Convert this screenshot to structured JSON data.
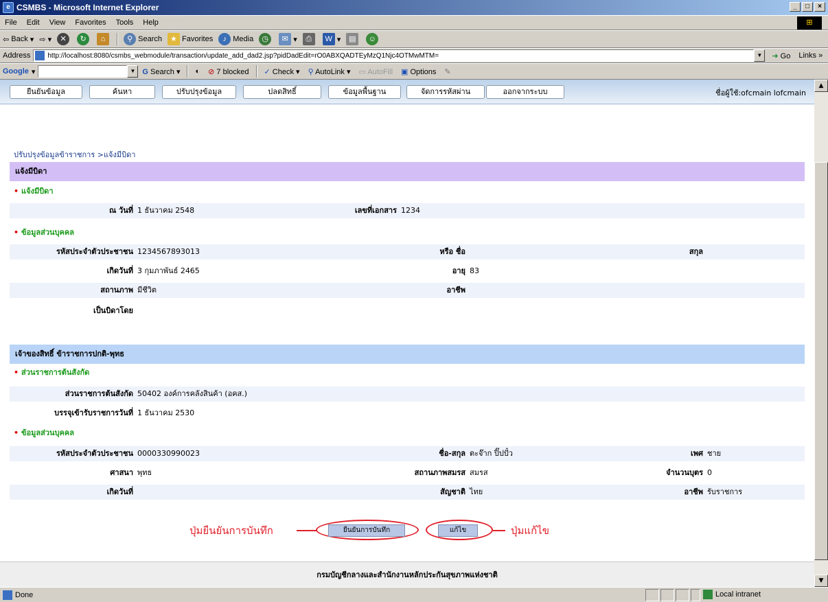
{
  "window": {
    "title": "CSMBS - Microsoft Internet Explorer",
    "controls": [
      "_",
      "□",
      "×"
    ]
  },
  "menu": [
    "File",
    "Edit",
    "View",
    "Favorites",
    "Tools",
    "Help"
  ],
  "toolbar": {
    "back": "Back",
    "search": "Search",
    "favorites": "Favorites",
    "media": "Media"
  },
  "address": {
    "label": "Address",
    "url": "http://localhost:8080/csmbs_webmodule/transaction/update_add_dad2.jsp?pidDadEdit=rO0ABXQADTEyMzQ1Njc4OTMwMTM=",
    "go": "Go",
    "links": "Links »"
  },
  "googlebar": {
    "brand": "Google",
    "search": "Search",
    "blocked": "7 blocked",
    "check": "Check",
    "autolink": "AutoLink",
    "autofill": "AutoFill",
    "options": "Options"
  },
  "nav": {
    "items": [
      "ยืนยันข้อมูล",
      "ค้นหา",
      "ปรับปรุงข้อมูล",
      "ปลดสิทธิ์",
      "ข้อมูลพื้นฐาน",
      "จัดการรหัสผ่าน",
      "ออกจากระบบ"
    ],
    "user": "ชื่อผู้ใช้:ofcmain lofcmain"
  },
  "breadcrumb": "ปรับปรุงข้อมูลข้าราชการ >แจ้งมีบิดา",
  "section1": {
    "header": "แจ้งมีบิดา",
    "sub1": "แจ้งมีบิดา",
    "date_label": "ณ วันที่",
    "date_value": "1 ธันวาคม 2548",
    "docno_label": "เลขที่เอกสาร",
    "docno_value": "1234",
    "sub2": "ข้อมูลส่วนบุคคล",
    "pid_label": "รหัสประจำตัวประชาชน",
    "pid_value": "1234567893013",
    "name_label": "หรือ ชื่อ",
    "surname_label": "สกุล",
    "birth_label": "เกิดวันที่",
    "birth_value": "3 กุมภาพันธ์ 2465",
    "age_label": "อายุ",
    "age_value": "83",
    "status_label": "สถานภาพ",
    "status_value": "มีชีวิต",
    "occupation_label": "อาชีพ",
    "father_by_label": "เป็นบิดาโดย"
  },
  "section2": {
    "header": "เจ้าของสิทธิ์ ข้าราชการปกติ-พุทธ",
    "sub1": "ส่วนราชการต้นสังกัด",
    "dept_label": "ส่วนราชการต้นสังกัด",
    "dept_value": "50402 องค์การคลังสินค้า (อคส.)",
    "start_label": "บรรจุเข้ารับราชการวันที่",
    "start_value": "1 ธันวาคม 2530",
    "sub2": "ข้อมูลส่วนบุคคล",
    "pid_label": "รหัสประจำตัวประชาชน",
    "pid_value": "0000330990023",
    "fullname_label": "ชื่อ-สกุล",
    "fullname_value": "ตะจ๊าก ปิ๊ปปั๋ว",
    "sex_label": "เพศ",
    "sex_value": "ชาย",
    "religion_label": "ศาสนา",
    "religion_value": "พุทธ",
    "marital_label": "สถานภาพสมรส",
    "marital_value": "สมรส",
    "children_label": "จำนวนบุตร",
    "children_value": "0",
    "birth_label": "เกิดวันที่",
    "nationality_label": "สัญชาติ",
    "nationality_value": "ไทย",
    "occupation_label": "อาชีพ",
    "occupation_value": "รับราชการ"
  },
  "actions": {
    "confirm": "ยืนยันการบันทึก",
    "edit": "แก้ไข",
    "annot_confirm": "ปุ่มยืนยันการบันทึก",
    "annot_edit": "ปุ่มแก้ไข"
  },
  "footer": "กรมบัญชีกลางและสำนักงานหลักประกันสุขภาพแห่งชาติ",
  "status": {
    "left": "Done",
    "zone": "Local intranet"
  },
  "colors": {
    "purple_header": "#d3bff5",
    "blue_header": "#b9d4f6",
    "annotation": "#e0202a",
    "subheading": "#1a9a1a"
  }
}
